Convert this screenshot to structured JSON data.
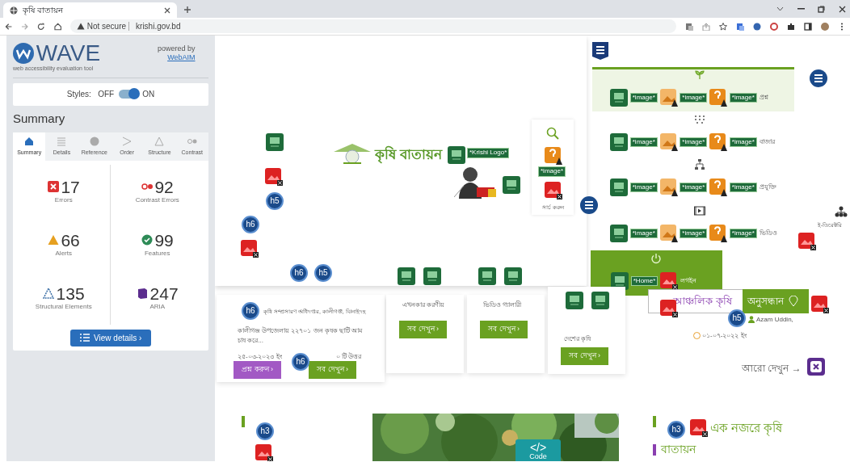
{
  "browser": {
    "tab_title": "কৃষি বাতায়ন",
    "tab_selected": true,
    "security": "Not secure",
    "url": "krishi.gov.bd"
  },
  "wave": {
    "title": "WAVE",
    "subtitle": "web accessibility evaluation tool",
    "powered_by": "powered by",
    "link": "WebAIM",
    "styles_label": "Styles:",
    "off_label": "OFF",
    "on_label": "ON",
    "styles_on": true,
    "heading": "Summary",
    "tabs": [
      {
        "label": "Summary",
        "selected": true
      },
      {
        "label": "Details",
        "selected": false
      },
      {
        "label": "Reference",
        "selected": false
      },
      {
        "label": "Order",
        "selected": false
      },
      {
        "label": "Structure",
        "selected": false
      },
      {
        "label": "Contrast",
        "selected": false
      }
    ],
    "stats": [
      {
        "kind": "error",
        "count": "17",
        "label": "Errors"
      },
      {
        "kind": "contrast",
        "count": "92",
        "label": "Contrast Errors"
      },
      {
        "kind": "alert",
        "count": "66",
        "label": "Alerts"
      },
      {
        "kind": "feature",
        "count": "99",
        "label": "Features"
      },
      {
        "kind": "structure",
        "count": "135",
        "label": "Structural Elements"
      },
      {
        "kind": "aria",
        "count": "247",
        "label": "ARIA"
      }
    ],
    "details_button": "View details ›"
  },
  "page": {
    "logo_text": "কৃষি বাতায়ন",
    "logo_alt": "*Krishi Logo*",
    "search_alt": "*image*",
    "search_label": "সার্চ করুন",
    "markers": [
      {
        "kind": "alt"
      },
      {
        "kind": "error"
      },
      {
        "kind": "heading",
        "text": "h5"
      },
      {
        "kind": "heading",
        "text": "h6"
      },
      {
        "kind": "error"
      },
      {
        "kind": "heading",
        "text": "h6"
      },
      {
        "kind": "heading",
        "text": "h5"
      },
      {
        "kind": "alt"
      },
      {
        "kind": "alt"
      },
      {
        "kind": "alt"
      },
      {
        "kind": "alt"
      },
      {
        "kind": "alt"
      },
      {
        "kind": "alt"
      },
      {
        "kind": "alert"
      },
      {
        "kind": "error"
      },
      {
        "kind": "list"
      },
      {
        "kind": "list"
      },
      {
        "kind": "nav"
      },
      {
        "kind": "alt"
      },
      {
        "kind": "alt"
      },
      {
        "kind": "heading",
        "text": "h6"
      },
      {
        "kind": "heading",
        "text": "h6"
      },
      {
        "kind": "heading",
        "text": "h5"
      },
      {
        "kind": "error"
      },
      {
        "kind": "error"
      },
      {
        "kind": "error"
      },
      {
        "kind": "aria"
      },
      {
        "kind": "heading",
        "text": "h3"
      },
      {
        "kind": "error"
      },
      {
        "kind": "heading",
        "text": "h3"
      },
      {
        "kind": "error"
      }
    ],
    "nav_rows": [
      {
        "alts": [
          "*image*",
          "*image*",
          "*image*"
        ],
        "label": "প্রশ্ন"
      },
      {
        "alts": [
          "*image*",
          "*image*",
          "*image*"
        ],
        "label": "বাজার"
      },
      {
        "alts": [
          "*image*",
          "*image*",
          "*image*"
        ],
        "label": "প্রযুক্তি"
      },
      {
        "alts": [
          "*image*",
          "*image*",
          "*image*"
        ],
        "label": "ভিডিও"
      }
    ],
    "home": {
      "alt": "*Home*",
      "label": "লগইন"
    },
    "directory": "ই-ডিরেক্টরি",
    "question_card": {
      "location": "কৃষি সম্প্রসারণ অধিদপ্তর, কালীগঞ্জ, ঝিনাইদহ",
      "text": "কালীগঞ্জ উপজেলায় ২২৭০১ জন কৃষক ছাটি আম চাষ করে...",
      "date": "২৫-০৩-২০২৩ ইং",
      "answers": "০ টি উত্তর",
      "ask_button": "প্রশ্ন করুন ›",
      "all_button": "সব দেখুন ›"
    },
    "cards": [
      {
        "title": "এখনকার করণীয়",
        "button": "সব দেখুন ›"
      },
      {
        "title": "ভিডিও গ্যালারী",
        "button": "সব দেখুন ›"
      },
      {
        "title": "দেশের কৃষি",
        "button": "সব দেখুন ›"
      }
    ],
    "regional": "আঞ্চলিক কৃষি",
    "search_button": "অনুসন্ধান",
    "author": "Azam Uddin,",
    "post_date": "০১-০৭-২০২২ ইং",
    "more_link": "আরো দেখুন →",
    "code_badge": {
      "symbol": "</>",
      "label": "Code"
    },
    "glance_title": "এক নজরে কৃষি",
    "glance_sub": "বাতায়ন"
  }
}
